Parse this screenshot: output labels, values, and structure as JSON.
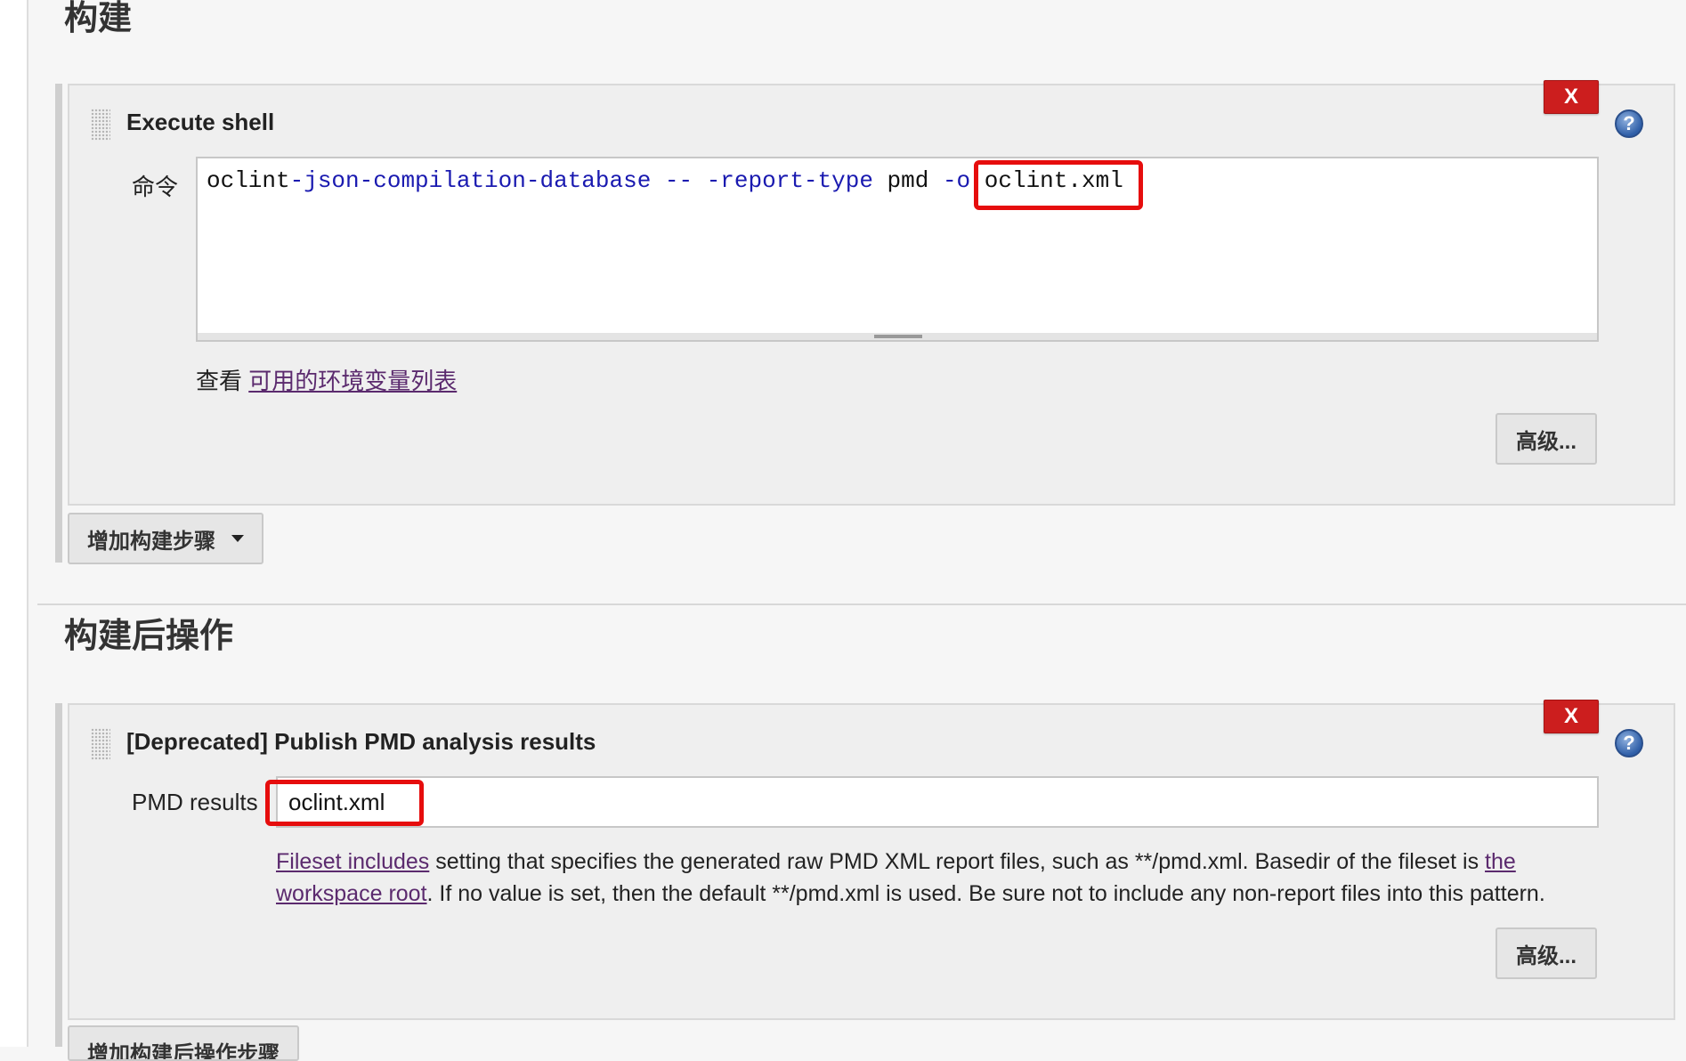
{
  "build": {
    "section_title": "构建",
    "step": {
      "title": "Execute shell",
      "close_label": "X",
      "help_label": "?",
      "command_label": "命令",
      "command": {
        "part1": "oclint",
        "part2": "-json-compilation-database -- -report-type",
        "part3": " pmd ",
        "part4": "-o",
        "part5": " oclint.xml"
      },
      "env_prefix": "查看 ",
      "env_link": "可用的环境变量列表",
      "advanced_label": "高级..."
    },
    "add_step_label": "增加构建步骤"
  },
  "post_build": {
    "section_title": "构建后操作",
    "step": {
      "title": "[Deprecated] Publish PMD analysis results",
      "close_label": "X",
      "help_label": "?",
      "pmd_label": "PMD results",
      "pmd_value": "oclint.xml",
      "desc_link1": "Fileset includes",
      "desc_text1": " setting that specifies the generated raw PMD XML report files, such as **/pmd.xml. Basedir of the fileset is ",
      "desc_link2": "the workspace root",
      "desc_text2": ". If no value is set, then the default **/pmd.xml is used. Be sure not to include any non-report files into this pattern.",
      "advanced_label": "高级..."
    },
    "add_step_label": "增加构建后操作步骤"
  },
  "colors": {
    "highlight": "#e60d0d",
    "close_button": "#cc1e1e",
    "link": "#5b2a6e",
    "keyword": "#1a1ab0"
  }
}
